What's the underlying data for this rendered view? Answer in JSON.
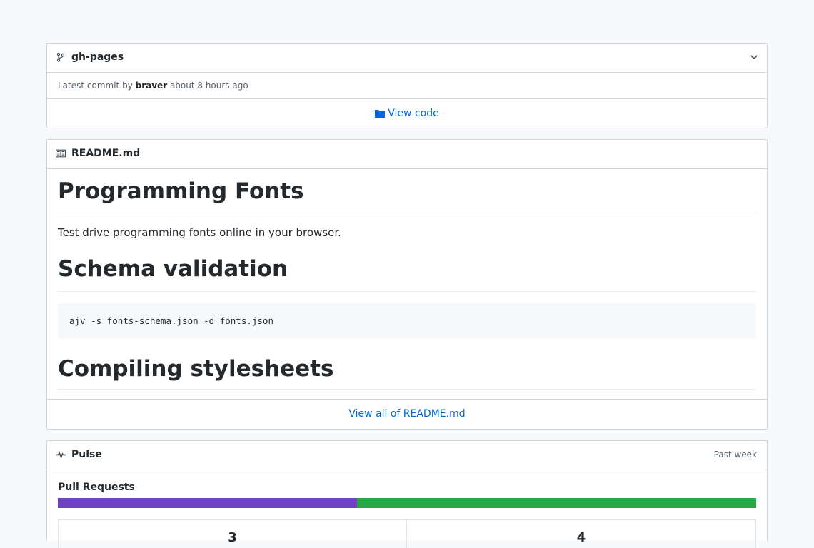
{
  "branch": {
    "name": "gh-pages",
    "commit_prefix": "Latest commit by",
    "commit_author": "braver",
    "commit_time": "about 8 hours ago",
    "view_code": "View code"
  },
  "readme": {
    "filename": "README.md",
    "h1_1": "Programming Fonts",
    "p1": "Test drive programming fonts online in your browser.",
    "h1_2": "Schema validation",
    "code": "ajv -s fonts-schema.json -d fonts.json",
    "h1_3": "Compiling stylesheets",
    "view_all": "View all of README.md"
  },
  "pulse": {
    "title": "Pulse",
    "period": "Past week",
    "pr_title": "Pull Requests",
    "merged_fraction": 0.428,
    "merged_count": "3",
    "open_count": "4",
    "colors": {
      "merged": "#6f42c1",
      "open": "#28a745"
    }
  }
}
